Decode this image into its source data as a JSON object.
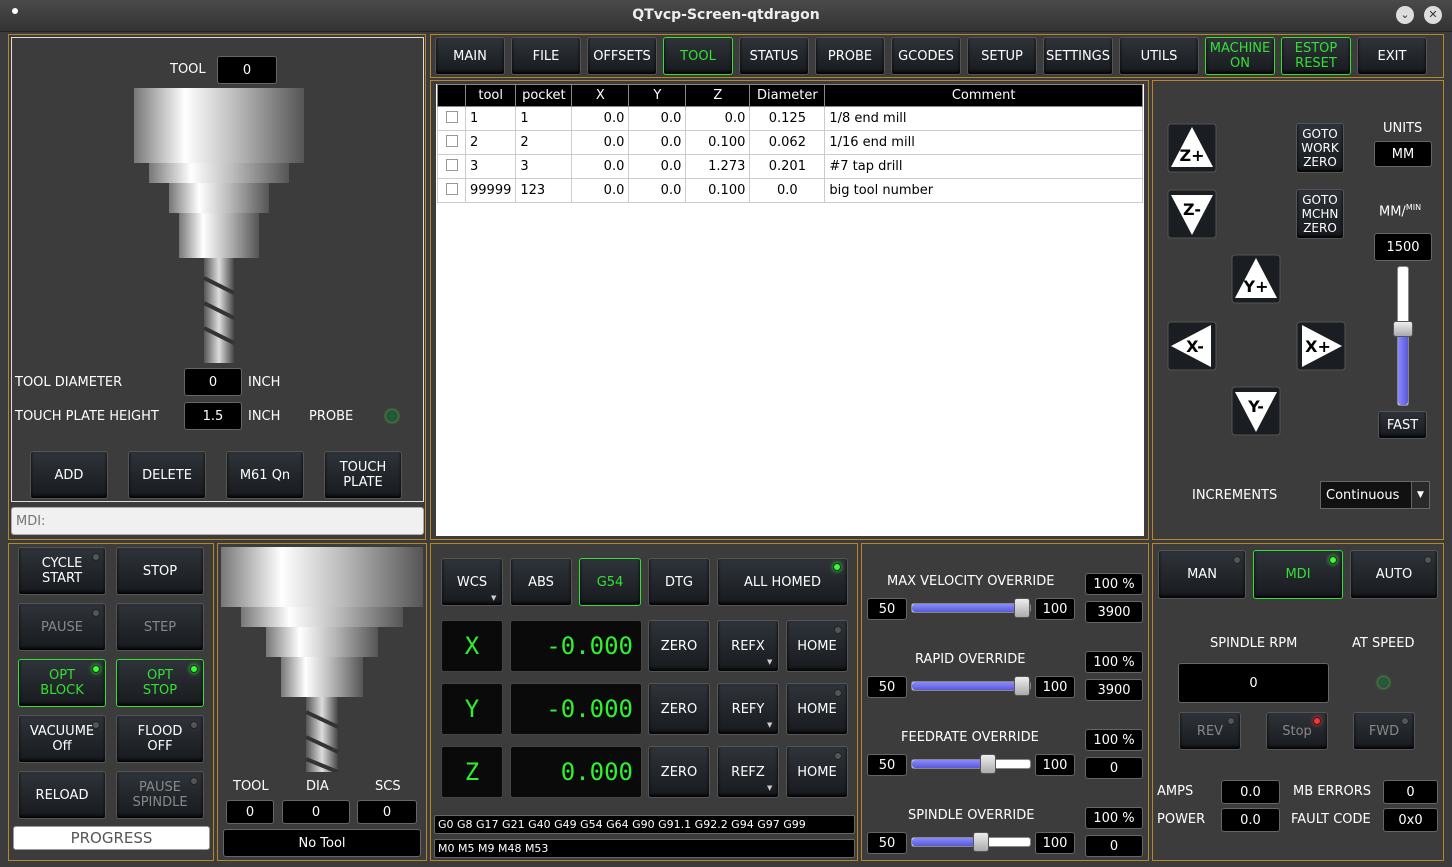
{
  "window": {
    "title": "QTvcp-Screen-qtdragon"
  },
  "tool_panel": {
    "tool_label": "TOOL",
    "tool_value": "0",
    "tool_diameter_label": "TOOL DIAMETER",
    "tool_diameter_value": "0",
    "tool_diameter_unit": "INCH",
    "touch_plate_label": "TOUCH PLATE HEIGHT",
    "touch_plate_value": "1.5",
    "touch_plate_unit": "INCH",
    "probe_label": "PROBE",
    "buttons": {
      "add": "ADD",
      "delete": "DELETE",
      "m61": "M61 Qn",
      "touch_plate": "TOUCH\nPLATE"
    },
    "mdi_placeholder": "MDI:"
  },
  "nav": {
    "main": "MAIN",
    "file": "FILE",
    "offsets": "OFFSETS",
    "tool": "TOOL",
    "status": "STATUS",
    "probe": "PROBE",
    "gcodes": "GCODES",
    "setup": "SETUP",
    "settings": "SETTINGS",
    "utils": "UTILS",
    "machine_on": "MACHINE\nON",
    "estop_reset": "ESTOP\nRESET",
    "exit": "EXIT"
  },
  "tool_table": {
    "headers": [
      "",
      "tool",
      "pocket",
      "X",
      "Y",
      "Z",
      "Diameter",
      "Comment"
    ],
    "rows": [
      {
        "tool": "1",
        "pocket": "1",
        "x": "0.0",
        "y": "0.0",
        "z": "0.0",
        "dia": "0.125",
        "comment": "1/8 end mill"
      },
      {
        "tool": "2",
        "pocket": "2",
        "x": "0.0",
        "y": "0.0",
        "z": "0.100",
        "dia": "0.062",
        "comment": "1/16 end mill"
      },
      {
        "tool": "3",
        "pocket": "3",
        "x": "0.0",
        "y": "0.0",
        "z": "1.273",
        "dia": "0.201",
        "comment": "#7 tap drill"
      },
      {
        "tool": "99999",
        "pocket": "123",
        "x": "0.0",
        "y": "0.0",
        "z": "0.100",
        "dia": "0.0",
        "comment": "big tool number"
      }
    ]
  },
  "jog": {
    "goto_work_zero": "GOTO\nWORK\nZERO",
    "goto_mchn_zero": "GOTO\nMCHN\nZERO",
    "units_label": "UNITS",
    "units_value": "MM",
    "rate_label": "MM/",
    "rate_sup": "MIN",
    "rate_value": "1500",
    "rate_level": 0.55,
    "fast": "FAST",
    "increments_label": "INCREMENTS",
    "increments_value": "Continuous",
    "keys": {
      "zp": "Z+",
      "zm": "Z-",
      "yp": "Y+",
      "ym": "Y-",
      "xp": "X+",
      "xm": "X-"
    }
  },
  "cycle": {
    "cycle_start": "CYCLE\nSTART",
    "stop": "STOP",
    "pause": "PAUSE",
    "step": "STEP",
    "opt_block": "OPT\nBLOCK",
    "opt_stop": "OPT\nSTOP",
    "vacuum": "VACUUME\nOff",
    "flood": "FLOOD\nOFF",
    "reload": "RELOAD",
    "pause_spindle": "PAUSE\nSPINDLE",
    "progress": "PROGRESS"
  },
  "tool_info": {
    "tool_label": "TOOL",
    "dia_label": "DIA",
    "scs_label": "SCS",
    "tool_value": "0",
    "dia_value": "0",
    "scs_value": "0",
    "name": "No Tool"
  },
  "dro": {
    "wcs": "WCS",
    "abs": "ABS",
    "g54": "G54",
    "dtg": "DTG",
    "all_homed": "ALL HOMED",
    "axes": [
      {
        "name": "X",
        "value": "-0.000",
        "zero": "ZERO",
        "ref": "REFX",
        "home": "HOME"
      },
      {
        "name": "Y",
        "value": "-0.000",
        "zero": "ZERO",
        "ref": "REFY",
        "home": "HOME"
      },
      {
        "name": "Z",
        "value": "0.000",
        "zero": "ZERO",
        "ref": "REFZ",
        "home": "HOME"
      }
    ],
    "gcodes": "G0 G8 G17 G21 G40 G49 G54 G64 G90 G91.1 G92.2 G94 G97 G99",
    "mcodes": "M0 M5 M9 M48 M53"
  },
  "overrides": [
    {
      "label": "MAX VELOCITY OVERRIDE",
      "min": "50",
      "max": "100",
      "pct": "100 %",
      "val": "3900",
      "level": 1.0
    },
    {
      "label": "RAPID OVERRIDE",
      "min": "50",
      "max": "100",
      "pct": "100 %",
      "val": "3900",
      "level": 1.0
    },
    {
      "label": "FEEDRATE OVERRIDE",
      "min": "50",
      "max": "100",
      "pct": "100 %",
      "val": "0",
      "level": 0.67
    },
    {
      "label": "SPINDLE OVERRIDE",
      "min": "50",
      "max": "100",
      "pct": "100 %",
      "val": "0",
      "level": 0.6
    }
  ],
  "mode": {
    "man": "MAN",
    "mdi": "MDI",
    "auto": "AUTO"
  },
  "spindle": {
    "rpm_label": "SPINDLE RPM",
    "at_speed_label": "AT SPEED",
    "rpm_value": "0",
    "rev": "REV",
    "stop": "Stop",
    "fwd": "FWD",
    "amps_label": "AMPS",
    "amps_value": "0.0",
    "mb_errors_label": "MB ERRORS",
    "mb_errors_value": "0",
    "power_label": "POWER",
    "power_value": "0.0",
    "fault_label": "FAULT CODE",
    "fault_value": "0x0"
  }
}
